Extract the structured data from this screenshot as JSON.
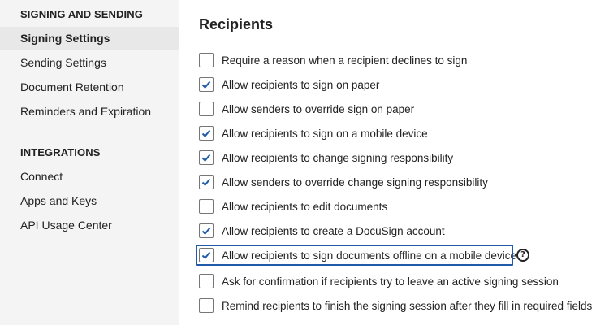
{
  "sidebar": {
    "section1_title": "SIGNING AND SENDING",
    "section1_items": [
      {
        "label": "Signing Settings",
        "active": true
      },
      {
        "label": "Sending Settings",
        "active": false
      },
      {
        "label": "Document Retention",
        "active": false
      },
      {
        "label": "Reminders and Expiration",
        "active": false
      }
    ],
    "section2_title": "INTEGRATIONS",
    "section2_items": [
      {
        "label": "Connect"
      },
      {
        "label": "Apps and Keys"
      },
      {
        "label": "API Usage Center"
      }
    ]
  },
  "main": {
    "title": "Recipients",
    "options": [
      {
        "label": "Require a reason when a recipient declines to sign",
        "checked": false
      },
      {
        "label": "Allow recipients to sign on paper",
        "checked": true
      },
      {
        "label": "Allow senders to override sign on paper",
        "checked": false
      },
      {
        "label": "Allow recipients to sign on a mobile device",
        "checked": true
      },
      {
        "label": "Allow recipients to change signing responsibility",
        "checked": true
      },
      {
        "label": "Allow senders to override change signing responsibility",
        "checked": true
      },
      {
        "label": "Allow recipients to edit documents",
        "checked": false
      },
      {
        "label": "Allow recipients to create a DocuSign account",
        "checked": true
      },
      {
        "label": "Allow recipients to sign documents offline on a mobile device",
        "checked": true,
        "focused": true
      },
      {
        "label": "Ask for confirmation if recipients try to leave an active signing session",
        "checked": false
      },
      {
        "label": "Remind recipients to finish the signing session after they fill in required fields",
        "checked": false
      }
    ],
    "help_icon": "help-circle-icon",
    "help_glyph": "?"
  },
  "colors": {
    "checkmark": "#1f5ba8",
    "focus_ring": "#1f5ba8",
    "sidebar_bg": "#f4f4f4",
    "active_item_bg": "#e8e8e8"
  }
}
